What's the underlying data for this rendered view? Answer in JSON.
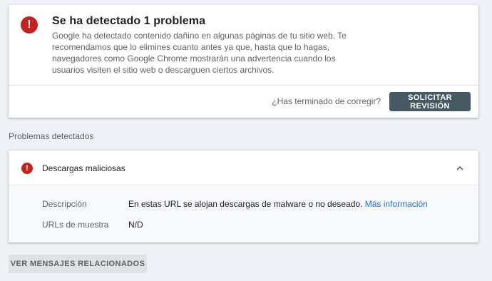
{
  "alert": {
    "icon": "error-icon",
    "title": "Se ha detectado 1 problema",
    "body": "Google ha detectado contenido dañino en algunas páginas de tu sitio web. Te recomendamos que lo elimines cuanto antes ya que, hasta que lo hagas, navegadores como Google Chrome mostrarán una advertencia cuando los usuarios visiten el sitio web o descarguen ciertos archivos.",
    "question": "¿Has terminado de corregir?",
    "request_review_label": "SOLICITAR REVISIÓN"
  },
  "problems": {
    "section_title": "Problemas detectados",
    "issue": {
      "icon": "error-icon",
      "title": "Descargas maliciosas",
      "expanded": true,
      "description_label": "Descripción",
      "description_value": "En estas URL se alojan descargas de malware o no deseado.",
      "more_info_link": "Más información",
      "sample_urls_label": "URLs de muestra",
      "sample_urls_value": "N/D"
    }
  },
  "footer": {
    "related_messages_label": "VER MENSAJES RELACIONADOS"
  },
  "colors": {
    "error_red": "#c5221f",
    "primary_button": "#455a64",
    "link_blue": "#1a73e8",
    "page_background": "#eef1f6"
  }
}
